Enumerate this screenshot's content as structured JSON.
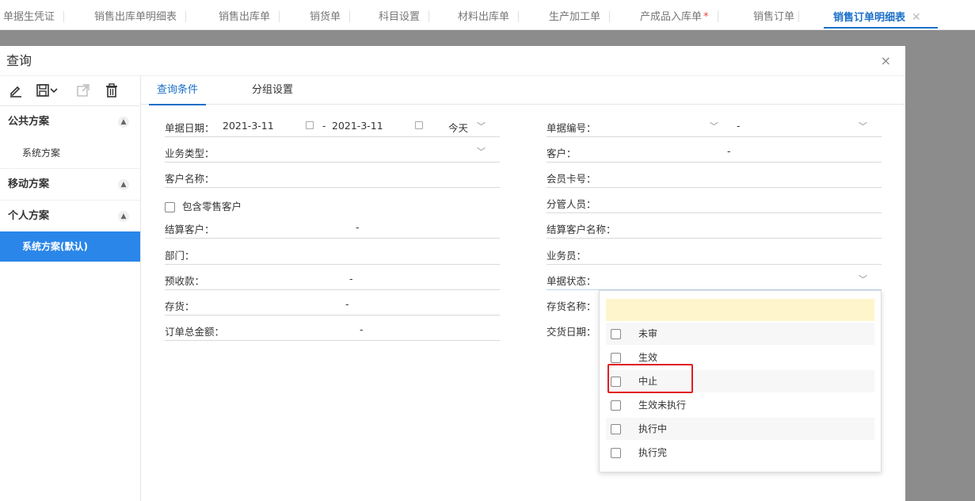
{
  "tabs": [
    {
      "label": "单据生凭证"
    },
    {
      "label": "销售出库单明细表"
    },
    {
      "label": "销售出库单"
    },
    {
      "label": "销货单"
    },
    {
      "label": "科目设置"
    },
    {
      "label": "材料出库单"
    },
    {
      "label": "生产加工单"
    },
    {
      "label": "产成品入库单",
      "star": "*"
    },
    {
      "label": "销售订单"
    },
    {
      "label": "销售订单明细表",
      "close": "✕"
    }
  ],
  "dialog": {
    "title": "查询",
    "close": "×"
  },
  "toolbar": {
    "icons": [
      "edit-icon",
      "save-icon",
      "export-icon",
      "delete-icon"
    ]
  },
  "plans": {
    "public": {
      "title": "公共方案",
      "items": [
        "系统方案"
      ]
    },
    "mobile": {
      "title": "移动方案"
    },
    "personal": {
      "title": "个人方案",
      "items": [
        "系统方案(默认)"
      ]
    }
  },
  "inner_tabs": [
    "查询条件",
    "分组设置"
  ],
  "form": {
    "date_label": "单据日期：",
    "date_from": "2021-3-11",
    "date_sep": "-",
    "date_to": "2021-3-11",
    "date_preset": "今天",
    "biz_type": "业务类型：",
    "cust_name": "客户名称：",
    "include_retail": "包含零售客户",
    "settle_cust": "结算客户：",
    "dept": "部门：",
    "prepay": "预收款：",
    "stock": "存货：",
    "total_amount": "订单总金额：",
    "bill_no": "单据编号：",
    "customer": "客户：",
    "member_card": "会员卡号：",
    "manager": "分管人员：",
    "settle_cust_name": "结算客户名称：",
    "salesman": "业务员：",
    "bill_status": "单据状态：",
    "stock_name": "存货名称：",
    "delivery_date": "交货日期：",
    "dash": "-"
  },
  "status_dropdown": {
    "search_value": "",
    "options": [
      "未审",
      "生效",
      "中止",
      "生效未执行",
      "执行中",
      "执行完"
    ],
    "highlighted": "中止"
  },
  "colors": {
    "accent": "#1a6fc8",
    "selected_bg": "#2a86e8",
    "highlight": "#e02020",
    "search_bg": "#fff5cc"
  }
}
